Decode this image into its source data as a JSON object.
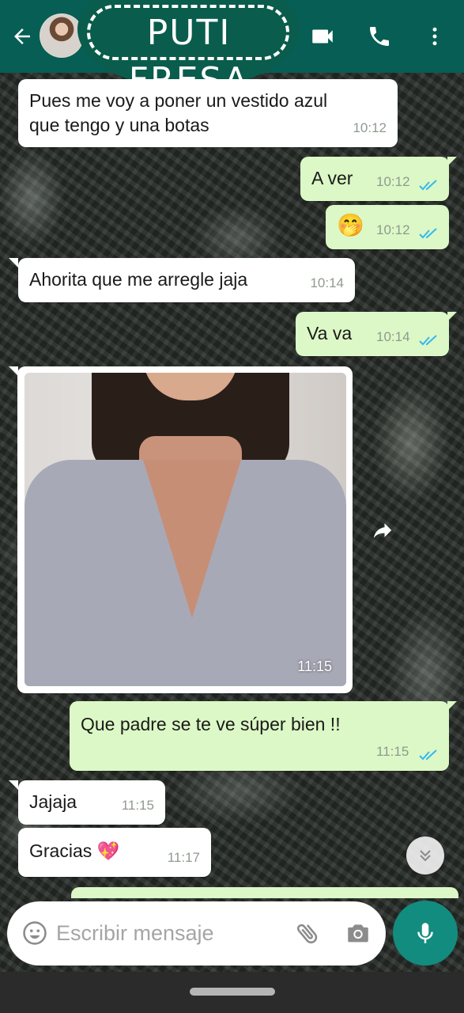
{
  "header": {
    "contact_name": "PUTI FRESA",
    "back_icon": "arrow-left-icon",
    "video_call_icon": "video-camera-icon",
    "voice_call_icon": "phone-icon",
    "menu_icon": "more-vertical-icon",
    "bg_color": "#075e54"
  },
  "messages": [
    {
      "direction": "in",
      "lines": [
        "Pues me voy a poner un vestido azul",
        "que tengo y una botas"
      ],
      "time": "10:12"
    },
    {
      "direction": "out",
      "text": "A ver",
      "time": "10:12",
      "status": "read"
    },
    {
      "direction": "out",
      "text": "🤭",
      "time": "10:12",
      "status": "read"
    },
    {
      "direction": "in",
      "text": "Ahorita que me arregle jaja",
      "time": "10:14"
    },
    {
      "direction": "out",
      "text": "Va va",
      "time": "10:14",
      "status": "read"
    },
    {
      "direction": "in",
      "type": "image",
      "time": "11:15"
    },
    {
      "direction": "out",
      "text": "Que padre se te ve súper bien !!",
      "time": "11:15",
      "status": "read"
    },
    {
      "direction": "in",
      "text": "Jajaja",
      "time": "11:15"
    },
    {
      "direction": "in",
      "text": "Gracias 💖",
      "time": "11:17"
    }
  ],
  "composer": {
    "placeholder": "Escribir mensaje",
    "emoji_icon": "emoji-icon",
    "attach_icon": "paperclip-icon",
    "camera_icon": "camera-icon",
    "mic_icon": "microphone-icon"
  },
  "colors": {
    "incoming_bubble": "#ffffff",
    "outgoing_bubble": "#dcf8c6",
    "read_ticks": "#34b7f1",
    "mic_button": "#128c7e"
  }
}
